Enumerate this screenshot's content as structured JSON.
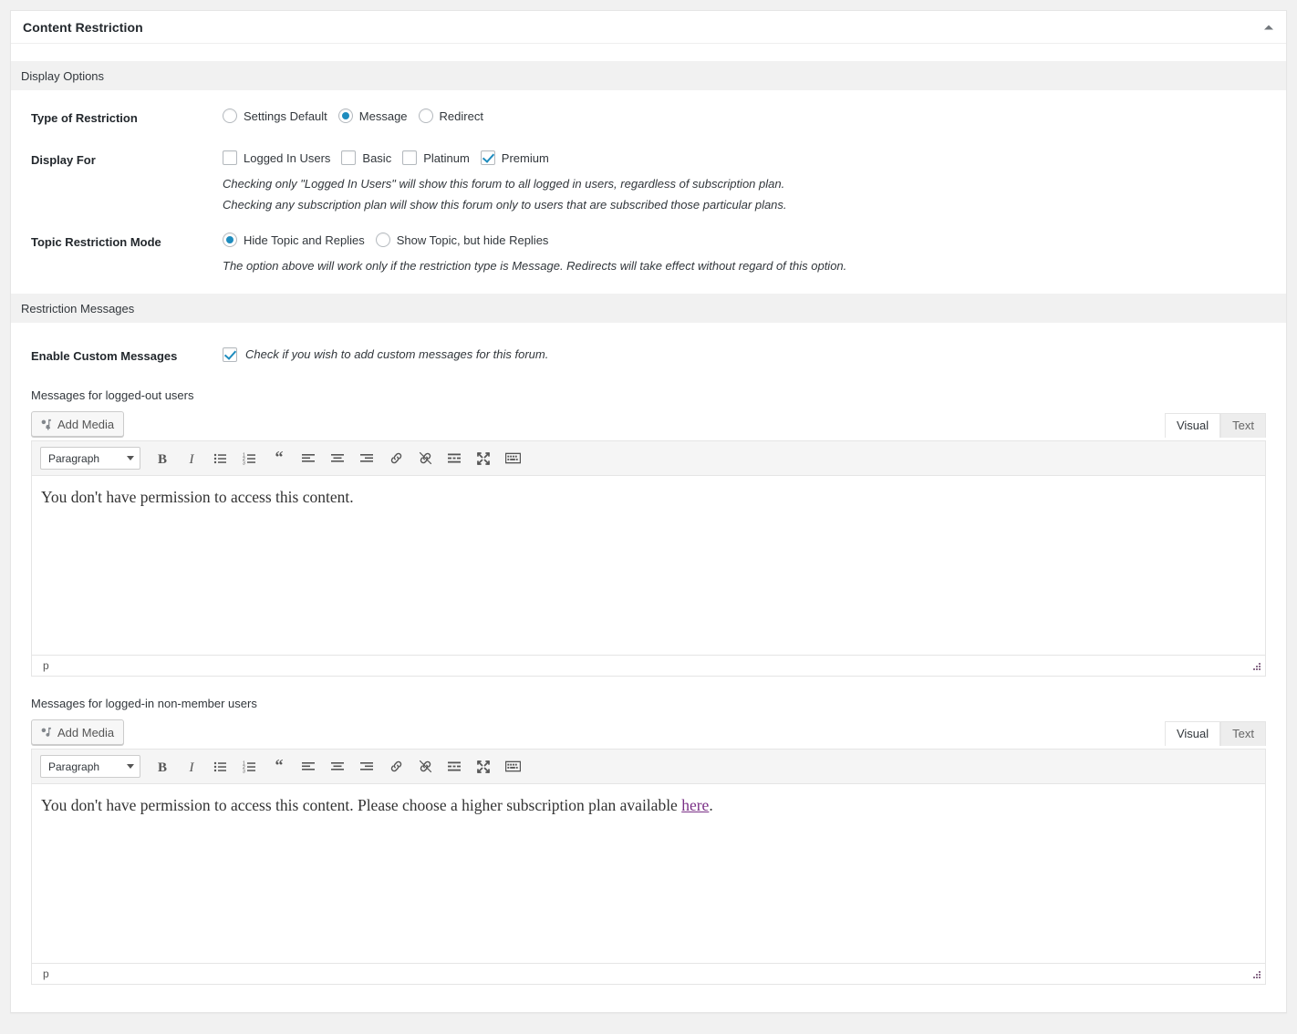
{
  "panel": {
    "title": "Content Restriction",
    "collapse_icon": "chevron-up-icon"
  },
  "sections": {
    "display_options": {
      "title": "Display Options"
    },
    "restriction_messages": {
      "title": "Restriction Messages"
    }
  },
  "type_of_restriction": {
    "label": "Type of Restriction",
    "options": [
      {
        "label": "Settings Default",
        "checked": false
      },
      {
        "label": "Message",
        "checked": true
      },
      {
        "label": "Redirect",
        "checked": false
      }
    ]
  },
  "display_for": {
    "label": "Display For",
    "options": [
      {
        "label": "Logged In Users",
        "checked": false
      },
      {
        "label": "Basic",
        "checked": false
      },
      {
        "label": "Platinum",
        "checked": false
      },
      {
        "label": "Premium",
        "checked": true
      }
    ],
    "help_1": "Checking only \"Logged In Users\" will show this forum to all logged in users, regardless of subscription plan.",
    "help_2": "Checking any subscription plan will show this forum only to users that are subscribed those particular plans."
  },
  "topic_restriction_mode": {
    "label": "Topic Restriction Mode",
    "options": [
      {
        "label": "Hide Topic and Replies",
        "checked": true
      },
      {
        "label": "Show Topic, but hide Replies",
        "checked": false
      }
    ],
    "help": "The option above will work only if the restriction type is Message. Redirects will take effect without regard of this option."
  },
  "enable_custom_messages": {
    "label": "Enable Custom Messages",
    "checked": true,
    "help": "Check if you wish to add custom messages for this forum."
  },
  "editors": [
    {
      "heading": "Messages for logged-out users",
      "add_media_label": "Add Media",
      "tab_visual": "Visual",
      "tab_text": "Text",
      "format_select": "Paragraph",
      "content_before": "You don't have permission to access this content.",
      "link_text": "",
      "content_after": "",
      "path_status": "p"
    },
    {
      "heading": "Messages for logged-in non-member users",
      "add_media_label": "Add Media",
      "tab_visual": "Visual",
      "tab_text": "Text",
      "format_select": "Paragraph",
      "content_before": "You don't have permission to access this content. Please choose a higher subscription plan available ",
      "link_text": "here",
      "content_after": ".",
      "path_status": "p"
    }
  ],
  "toolbar_icons": [
    "bold-icon",
    "italic-icon",
    "bulleted-list-icon",
    "numbered-list-icon",
    "blockquote-icon",
    "align-left-icon",
    "align-center-icon",
    "align-right-icon",
    "link-icon",
    "unlink-icon",
    "insert-read-more-icon",
    "fullscreen-icon",
    "toolbar-toggle-icon"
  ],
  "colors": {
    "accent": "#1e8cbe",
    "page_bg": "#f1f1f1",
    "panel_bg": "#ffffff",
    "border": "#e5e5e5",
    "text": "#32373c",
    "link_visited": "#7a2f86"
  }
}
